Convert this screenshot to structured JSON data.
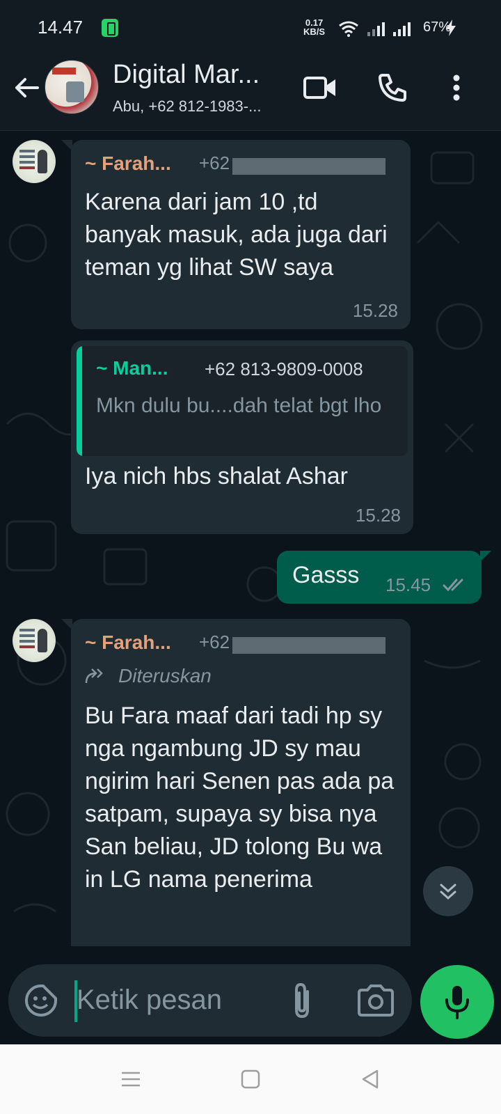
{
  "status_bar": {
    "time": "14.47",
    "net_speed_value": "0.17",
    "net_speed_unit": "KB/S",
    "battery_percent": "67%",
    "icons": [
      "battery-saver-icon",
      "wifi-icon",
      "signal-icon",
      "signal-icon",
      "charging-icon"
    ]
  },
  "header": {
    "title": "Digital Mar...",
    "subtitle": "Abu, +62 812-1983-...",
    "icons": [
      "back-arrow-icon",
      "video-call-icon",
      "phone-call-icon",
      "more-vert-icon"
    ]
  },
  "messages": [
    {
      "sender": "~ Farah...",
      "sender_number_prefix": "+62",
      "text": "Karena dari jam 10 ,td banyak masuk, ada juga dari teman yg lihat SW saya",
      "time": "15.28"
    },
    {
      "quoted_sender": "~ Man...",
      "quoted_number": "+62 813-9809-0008",
      "quoted_text": "Mkn dulu bu....dah telat bgt lho",
      "text": "Iya nich hbs shalat Ashar",
      "time": "15.28"
    },
    {
      "text": "Gasss",
      "time": "15.45",
      "status_icon": "double-check-icon"
    },
    {
      "sender": "~ Farah...",
      "sender_number_prefix": "+62",
      "forwarded_label": "Diteruskan",
      "text": "Bu Fara maaf dari tadi hp sy nga ngambung JD sy mau ngirim hari Senen pas ada pa satpam, supaya sy bisa nya San beliau, JD tolong Bu wa in LG nama penerima"
    }
  ],
  "composer": {
    "placeholder": "Ketik pesan",
    "icons": [
      "sticker-icon",
      "attach-icon",
      "camera-icon",
      "mic-icon"
    ]
  },
  "colors": {
    "background": "#0b141a",
    "bubble_in": "#202c33",
    "bubble_out": "#005c4b",
    "accent_green": "#21c063",
    "sender_color": "#e5a27a",
    "quote_color": "#06cf9c"
  }
}
